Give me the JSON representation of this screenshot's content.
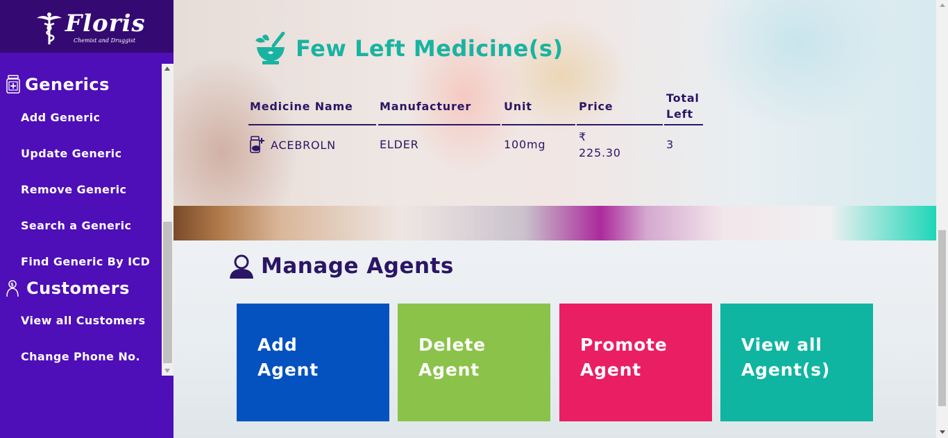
{
  "brand": {
    "name": "Floris",
    "tagline": "Chemist and Druggist"
  },
  "sidebar": {
    "sections": [
      {
        "title": "Generics",
        "icon": "medicine-jar-icon",
        "items": [
          "Add Generic",
          "Update Generic",
          "Remove Generic",
          "Search a Generic",
          "Find Generic By ICD"
        ]
      },
      {
        "title": "Customers",
        "icon": "customer-icon",
        "items": [
          "View all Customers",
          "Change Phone No."
        ]
      }
    ]
  },
  "medicine": {
    "title": "Few Left Medicine(s)",
    "icon": "mortar-pestle-icon",
    "headers": {
      "name": "Medicine Name",
      "manufacturer": "Manufacturer",
      "unit": "Unit",
      "price": "Price",
      "total_left_line1": "Total",
      "total_left_line2": "Left"
    },
    "rows": [
      {
        "icon": "pills-icon",
        "name": "ACEBROLN",
        "manufacturer": "ELDER",
        "unit": "100mg",
        "currency": "₹",
        "price": "225.30",
        "total_left": "3"
      }
    ]
  },
  "agents": {
    "title": "Manage Agents",
    "icon": "user-icon",
    "tiles": [
      {
        "line1": "Add",
        "line2": "Agent",
        "color": "#0452bf"
      },
      {
        "line1": "Delete",
        "line2": "Agent",
        "color": "#8bc34a"
      },
      {
        "line1": "Promote",
        "line2": "Agent",
        "color": "#ea1e63"
      },
      {
        "line1": "View all",
        "line2": "Agent(s)",
        "color": "#0fb5a1"
      }
    ]
  },
  "colors": {
    "sidebar": "#4e0eb8",
    "logo_bar": "#340a72",
    "accent_teal": "#19b3a1",
    "text_dark": "#2b1565"
  }
}
